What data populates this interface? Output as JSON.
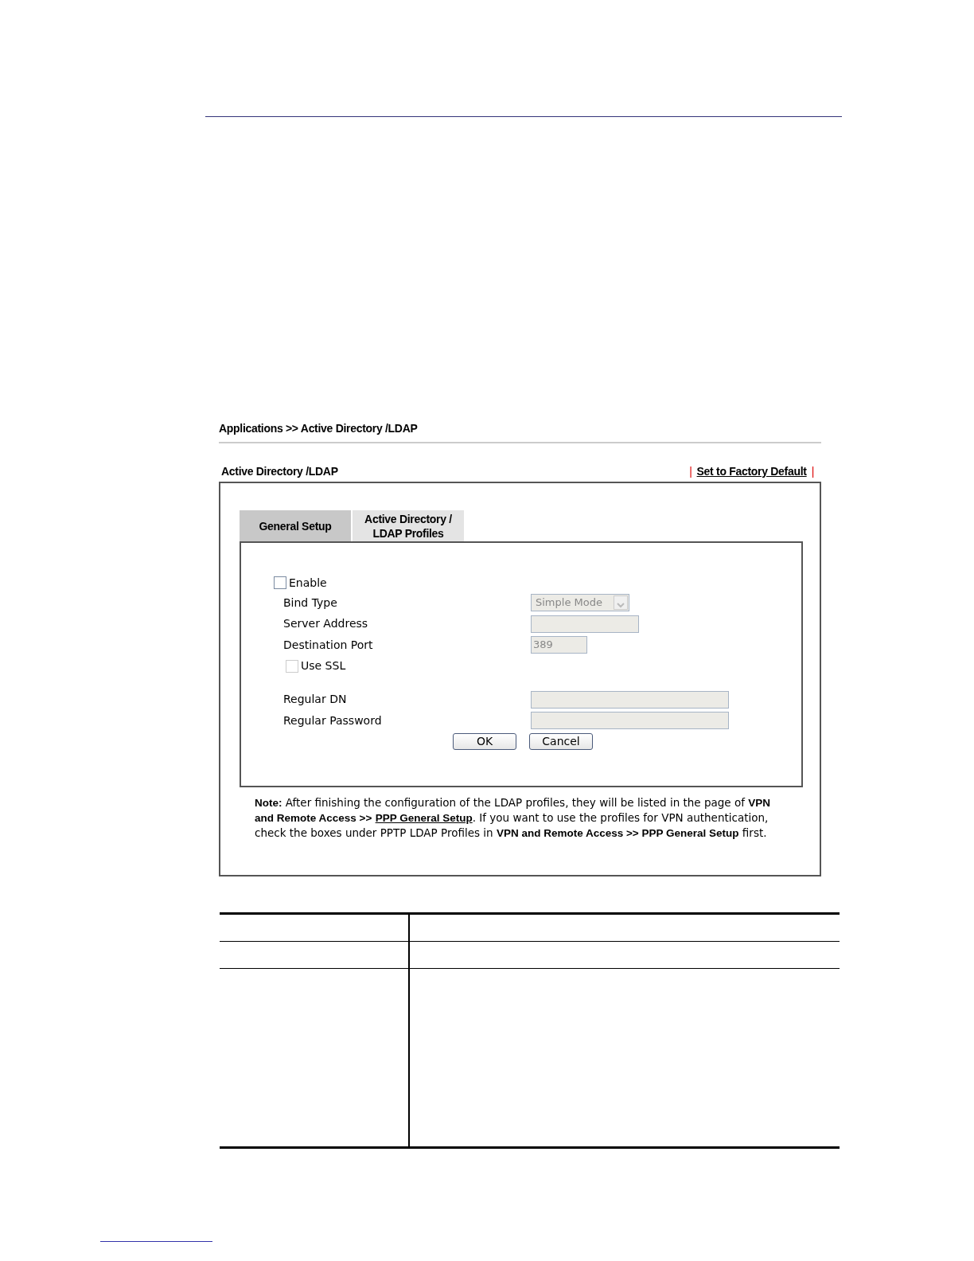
{
  "breadcrumb": "Applications >> Active Directory /LDAP",
  "panel": {
    "title": "Active Directory /LDAP",
    "separator_left": "|",
    "factory_link": "Set to Factory Default",
    "separator_right": "|"
  },
  "tabs": [
    {
      "label": "General Setup",
      "selected": true
    },
    {
      "label": "Active Directory /\nLDAP Profiles",
      "selected": false
    }
  ],
  "form": {
    "enable": {
      "label": "Enable",
      "checked": false
    },
    "fields": [
      {
        "kind": "select",
        "label": "Bind Type",
        "value": "Simple Mode",
        "disabled": true
      },
      {
        "kind": "text",
        "label": "Server Address",
        "disabled": true
      },
      {
        "kind": "port",
        "label": "Destination Port",
        "value": "389",
        "disabled": true
      },
      {
        "kind": "checkbox",
        "label": "Use SSL",
        "checked": false,
        "disabled": true
      },
      {
        "kind": "wide",
        "label": "Regular DN",
        "disabled": true
      },
      {
        "kind": "wide",
        "label": "Regular Password",
        "disabled": true
      }
    ],
    "buttons": [
      "OK",
      "Cancel"
    ]
  },
  "note": [
    {
      "kind": "text",
      "text": "**Note:** After finishing the configuration of the LDAP profiles, they will be listed in the page of **VPN and Remote Access >>** "
    },
    {
      "kind": "link",
      "text": "PPP General Setup"
    },
    {
      "kind": "text",
      "text": ". If you want to use the profiles for VPN authentication, check the boxes under PPTP LDAP Profiles in **VPN and Remote Access >> PPP General Setup** first."
    }
  ]
}
